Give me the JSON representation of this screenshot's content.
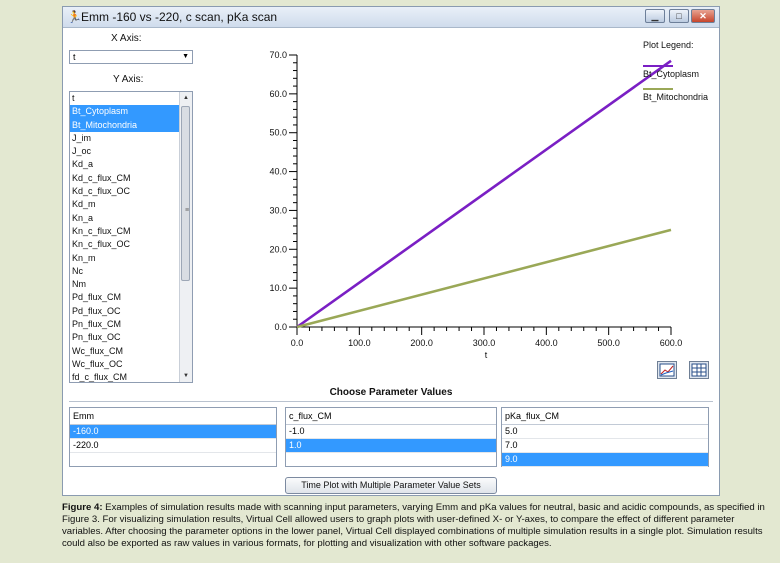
{
  "window": {
    "title": "Emm -160 vs -220, c scan, pKa scan"
  },
  "x_axis": {
    "label": "X Axis:",
    "selected": "t"
  },
  "y_axis": {
    "label": "Y Axis:",
    "items": [
      {
        "label": "t",
        "selected": false
      },
      {
        "label": "Bt_Cytoplasm",
        "selected": true
      },
      {
        "label": "Bt_Mitochondria",
        "selected": true
      },
      {
        "label": "J_im",
        "selected": false
      },
      {
        "label": "J_oc",
        "selected": false
      },
      {
        "label": "Kd_a",
        "selected": false
      },
      {
        "label": "Kd_c_flux_CM",
        "selected": false
      },
      {
        "label": "Kd_c_flux_OC",
        "selected": false
      },
      {
        "label": "Kd_m",
        "selected": false
      },
      {
        "label": "Kn_a",
        "selected": false
      },
      {
        "label": "Kn_c_flux_CM",
        "selected": false
      },
      {
        "label": "Kn_c_flux_OC",
        "selected": false
      },
      {
        "label": "Kn_m",
        "selected": false
      },
      {
        "label": "Nc",
        "selected": false
      },
      {
        "label": "Nm",
        "selected": false
      },
      {
        "label": "Pd_flux_CM",
        "selected": false
      },
      {
        "label": "Pd_flux_OC",
        "selected": false
      },
      {
        "label": "Pn_flux_CM",
        "selected": false
      },
      {
        "label": "Pn_flux_OC",
        "selected": false
      },
      {
        "label": "Wc_flux_CM",
        "selected": false
      },
      {
        "label": "Wc_flux_OC",
        "selected": false
      },
      {
        "label": "fd_c_flux_CM",
        "selected": false
      }
    ]
  },
  "chart_data": {
    "type": "line",
    "xlabel": "t",
    "ylabel": "",
    "xlim": [
      0,
      600
    ],
    "ylim": [
      0,
      70
    ],
    "x_ticks": [
      "0.0",
      "100.0",
      "200.0",
      "300.0",
      "400.0",
      "500.0",
      "600.0"
    ],
    "y_ticks": [
      "0.0",
      "10.0",
      "20.0",
      "30.0",
      "40.0",
      "50.0",
      "60.0",
      "70.0"
    ],
    "grid": false,
    "legend_title": "Plot Legend:",
    "series": [
      {
        "name": "Bt_Cytoplasm",
        "color": "#7a1fc4",
        "x": [
          0,
          600
        ],
        "y": [
          0,
          68.5
        ]
      },
      {
        "name": "Bt_Mitochondria",
        "color": "#9aa857",
        "x": [
          0,
          600
        ],
        "y": [
          0,
          25.0
        ]
      }
    ]
  },
  "params": {
    "title": "Choose Parameter Values",
    "tables": [
      {
        "header": "Emm",
        "rows": [
          {
            "value": "-160.0",
            "selected": true
          },
          {
            "value": "-220.0",
            "selected": false
          }
        ]
      },
      {
        "header": "c_flux_CM",
        "rows": [
          {
            "value": "-1.0",
            "selected": false
          },
          {
            "value": "1.0",
            "selected": true
          }
        ]
      },
      {
        "header": "pKa_flux_CM",
        "rows": [
          {
            "value": "5.0",
            "selected": false
          },
          {
            "value": "7.0",
            "selected": false
          },
          {
            "value": "9.0",
            "selected": true
          }
        ]
      }
    ],
    "button_label": "Time Plot with Multiple Parameter Value Sets"
  },
  "caption": {
    "lead": "Figure 4:",
    "text": " Examples of simulation results made with scanning input parameters, varying Emm and pKa values for neutral, basic and acidic compounds, as specified in Figure 3. For visualizing simulation results, Virtual Cell allowed users to graph plots with user-defined X- or Y-axes, to compare the effect of different parameter variables. After choosing the parameter options in the lower panel, Virtual Cell displayed combinations of multiple simulation results in a single plot. Simulation results could also be exported as raw values in various formats, for plotting and visualization with other software packages."
  }
}
